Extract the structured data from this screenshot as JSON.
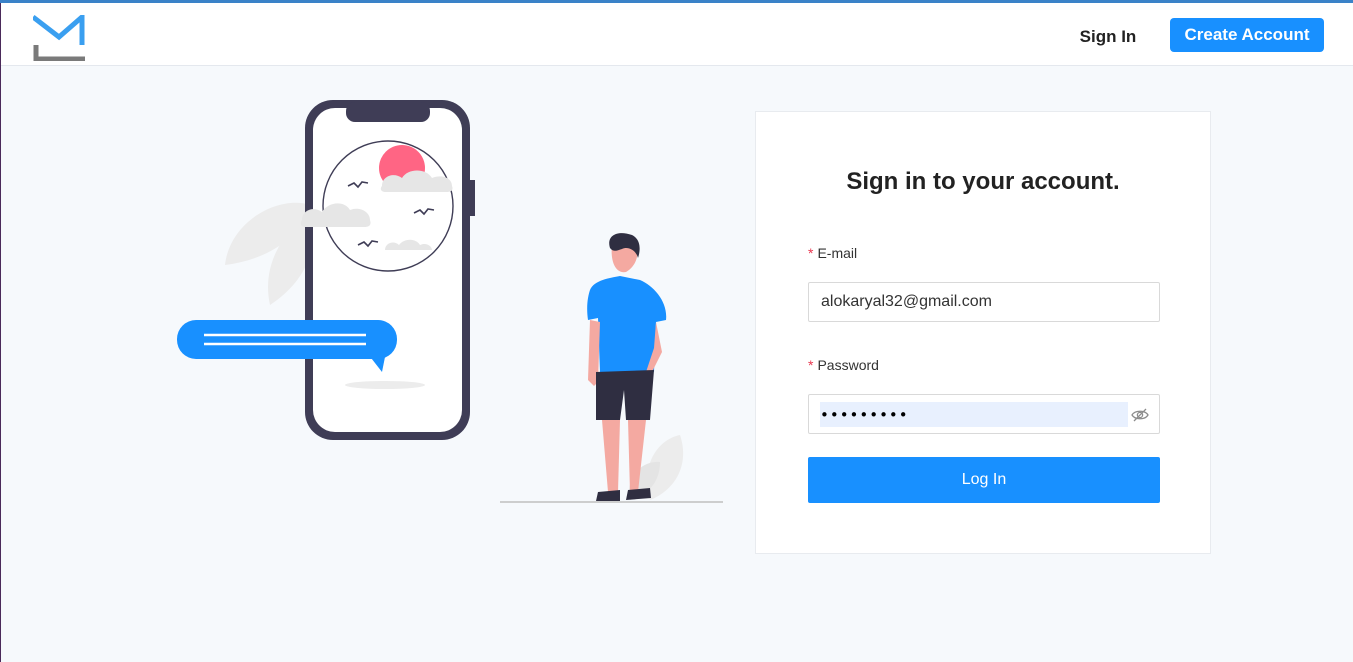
{
  "header": {
    "signin_label": "Sign In",
    "create_account_label": "Create Account"
  },
  "form": {
    "title": "Sign in to your account.",
    "email": {
      "label": "E-mail",
      "value": "alokaryal32@gmail.com"
    },
    "password": {
      "label": "Password",
      "masked_value": "•••••••••"
    },
    "required_marker": "*",
    "login_label": "Log In"
  },
  "icons": {
    "logo": "brand-logo",
    "password_toggle": "eye-hidden-icon"
  },
  "colors": {
    "primary": "#1890ff",
    "top_strip": "#3a82c8",
    "background": "#f6f9fc",
    "required": "#e8374f"
  }
}
